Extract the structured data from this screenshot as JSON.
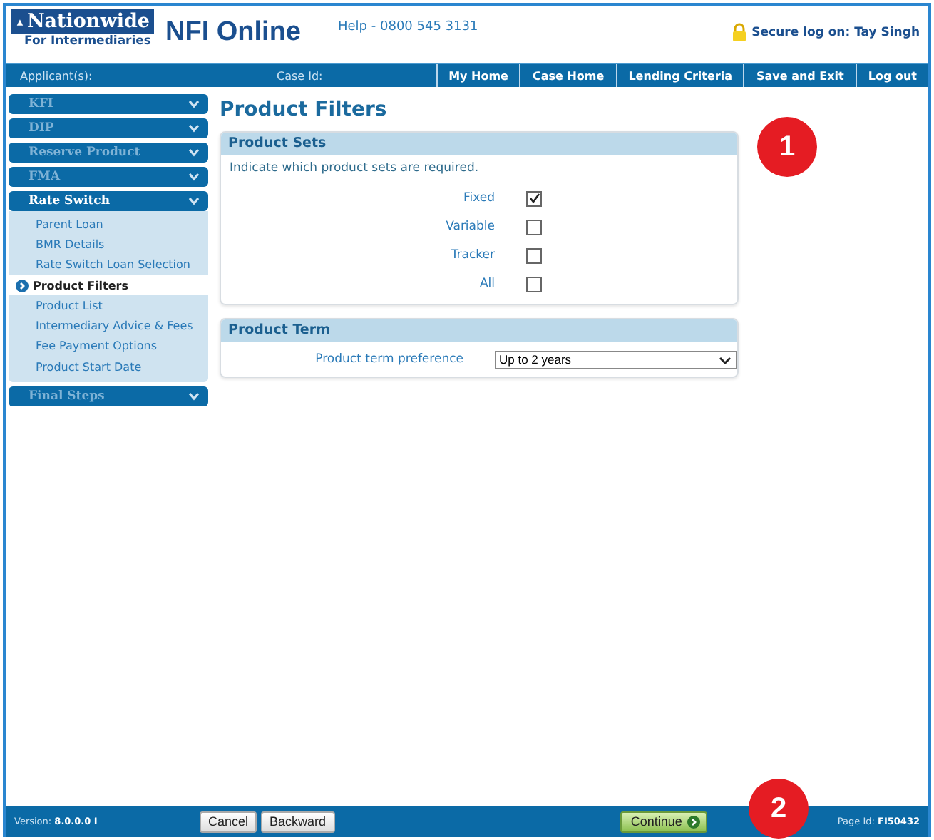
{
  "header": {
    "logo_brand": "Nationwide",
    "logo_sub": "For Intermediaries",
    "product": "NFI Online",
    "help": "Help - 0800 545 3131",
    "secure_logon": "Secure log on: Tay Singh"
  },
  "nav_bar": {
    "applicants": "Applicant(s):",
    "case_id": "Case Id:",
    "links": [
      "My Home",
      "Case Home",
      "Lending Criteria",
      "Save and Exit",
      "Log out"
    ]
  },
  "sidebar": {
    "sections": [
      {
        "label": "KFI",
        "expanded": false,
        "disabled": true
      },
      {
        "label": "DIP",
        "expanded": false,
        "disabled": true
      },
      {
        "label": "Reserve Product",
        "expanded": false,
        "disabled": true
      },
      {
        "label": "FMA",
        "expanded": false,
        "disabled": true
      },
      {
        "label": "Rate Switch",
        "expanded": true,
        "disabled": false,
        "children": [
          {
            "label": "Parent Loan",
            "selected": false
          },
          {
            "label": "BMR Details",
            "selected": false
          },
          {
            "label": "Rate Switch Loan Selection",
            "selected": false
          },
          {
            "label": "Product Filters",
            "selected": true
          },
          {
            "label": "Product List",
            "selected": false
          },
          {
            "label": "Intermediary Advice & Fees",
            "selected": false
          },
          {
            "label": "Fee Payment Options",
            "selected": false
          },
          {
            "label": "Product Start Date",
            "selected": false
          }
        ]
      },
      {
        "label": "Final Steps",
        "expanded": false,
        "disabled": true
      }
    ]
  },
  "main": {
    "title": "Product Filters",
    "product_sets": {
      "heading": "Product Sets",
      "instruction": "Indicate which product sets are required.",
      "options": [
        {
          "label": "Fixed",
          "checked": true
        },
        {
          "label": "Variable",
          "checked": false
        },
        {
          "label": "Tracker",
          "checked": false
        },
        {
          "label": "All",
          "checked": false
        }
      ]
    },
    "product_term": {
      "heading": "Product Term",
      "label": "Product term preference",
      "value": "Up to 2 years"
    }
  },
  "footer": {
    "version": "Version: **8.0.0.0 I**",
    "buttons": [
      "Cancel",
      "Backward"
    ],
    "continue": "Continue",
    "page_id": "Page Id: **FI50432**"
  },
  "callouts": [
    "1",
    "2"
  ]
}
